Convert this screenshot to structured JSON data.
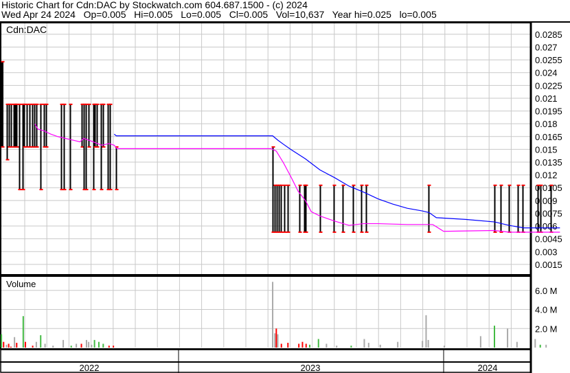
{
  "header": {
    "title": "Historic Chart for Cdn:DAC by Stockwatch.com 604.687.1500 - (c) 2024",
    "stats": "Wed Apr 24 2024   Op=0.005   Hi=0.005   Lo=0.005   Cl=0.005   Vol=10,637   Year hi=0.025   lo=0.005"
  },
  "chart_data": [
    {
      "type": "bar",
      "title": "Cdn:DAC",
      "ylim": [
        0,
        0.0295
      ],
      "xlim": [
        0,
        730
      ],
      "yticks": [
        "0.0285",
        "0.027",
        "0.0255",
        "0.024",
        "0.0225",
        "0.021",
        "0.0195",
        "0.018",
        "0.0165",
        "0.015",
        "0.0135",
        "0.012",
        "0.0105",
        "0.009",
        "0.0075",
        "0.006",
        "0.0045",
        "0.003",
        "0.0015"
      ],
      "ytick_values": [
        0.0285,
        0.027,
        0.0255,
        0.024,
        0.0225,
        0.021,
        0.0195,
        0.018,
        0.0165,
        0.015,
        0.0135,
        0.012,
        0.0105,
        0.009,
        0.0075,
        0.006,
        0.0045,
        0.003,
        0.0015
      ],
      "bars": [
        [
          3,
          0.025,
          0.015
        ],
        [
          9,
          0.02,
          0.0135
        ],
        [
          12,
          0.02,
          0.015
        ],
        [
          15,
          0.02,
          0.015
        ],
        [
          19,
          0.02,
          0.015
        ],
        [
          21,
          0.02,
          0.015
        ],
        [
          23,
          0.02,
          0.015
        ],
        [
          26,
          0.02,
          0.01
        ],
        [
          31,
          0.02,
          0.01
        ],
        [
          33,
          0.02,
          0.015
        ],
        [
          37,
          0.02,
          0.015
        ],
        [
          41,
          0.02,
          0.015
        ],
        [
          44,
          0.02,
          0.015
        ],
        [
          47,
          0.02,
          0.015
        ],
        [
          50,
          0.02,
          0.015
        ],
        [
          56,
          0.02,
          0.01
        ],
        [
          60,
          0.02,
          0.015
        ],
        [
          63,
          0.02,
          0.015
        ],
        [
          84,
          0.02,
          0.01
        ],
        [
          88,
          0.02,
          0.01
        ],
        [
          96,
          0.02,
          0.01
        ],
        [
          112,
          0.02,
          0.015
        ],
        [
          115,
          0.02,
          0.01
        ],
        [
          118,
          0.02,
          0.01
        ],
        [
          122,
          0.02,
          0.015
        ],
        [
          128,
          0.02,
          0.01
        ],
        [
          130,
          0.02,
          0.015
        ],
        [
          133,
          0.02,
          0.015
        ],
        [
          139,
          0.02,
          0.01
        ],
        [
          142,
          0.02,
          0.015
        ],
        [
          148,
          0.02,
          0.01
        ],
        [
          151,
          0.02,
          0.01
        ],
        [
          160,
          0.015,
          0.01
        ],
        [
          375,
          0.015,
          0.005
        ],
        [
          378,
          0.0105,
          0.005
        ],
        [
          381,
          0.0105,
          0.005
        ],
        [
          383,
          0.0105,
          0.005
        ],
        [
          386,
          0.0105,
          0.005
        ],
        [
          391,
          0.0105,
          0.005
        ],
        [
          396,
          0.0105,
          0.005
        ],
        [
          412,
          0.0105,
          0.005
        ],
        [
          418,
          0.0105,
          0.005
        ],
        [
          420,
          0.0105,
          0.005
        ],
        [
          440,
          0.0105,
          0.005
        ],
        [
          459,
          0.0105,
          0.005
        ],
        [
          471,
          0.0105,
          0.005
        ],
        [
          485,
          0.0105,
          0.005
        ],
        [
          497,
          0.0105,
          0.005
        ],
        [
          503,
          0.0105,
          0.005
        ],
        [
          589,
          0.0105,
          0.005
        ],
        [
          680,
          0.0105,
          0.005
        ],
        [
          688,
          0.0105,
          0.005
        ],
        [
          700,
          0.0105,
          0.005
        ],
        [
          712,
          0.0105,
          0.005
        ],
        [
          719,
          0.0105,
          0.005
        ],
        [
          739,
          0.0105,
          0.005
        ],
        [
          743,
          0.0105,
          0.005
        ],
        [
          757,
          0.0105,
          0.005
        ]
      ],
      "series": [
        {
          "name": "long-ma",
          "color": "#0000ff",
          "points": [
            [
              157,
              0.0165
            ],
            [
              160,
              0.0163
            ],
            [
              375,
              0.0163
            ],
            [
              382,
              0.0158
            ],
            [
              390,
              0.0153
            ],
            [
              400,
              0.0147
            ],
            [
              420,
              0.0136
            ],
            [
              440,
              0.0123
            ],
            [
              460,
              0.0114
            ],
            [
              480,
              0.0104
            ],
            [
              500,
              0.0097
            ],
            [
              520,
              0.0089
            ],
            [
              540,
              0.0083
            ],
            [
              560,
              0.0078
            ],
            [
              580,
              0.0075
            ],
            [
              590,
              0.0073
            ],
            [
              600,
              0.0067
            ],
            [
              640,
              0.0065
            ],
            [
              680,
              0.0062
            ],
            [
              700,
              0.0058
            ],
            [
              720,
              0.0055
            ],
            [
              770,
              0.0055
            ]
          ]
        },
        {
          "name": "short-ma",
          "color": "#ff00ff",
          "points": [
            [
              48,
              0.0177
            ],
            [
              52,
              0.0171
            ],
            [
              60,
              0.0169
            ],
            [
              70,
              0.0165
            ],
            [
              80,
              0.0162
            ],
            [
              90,
              0.016
            ],
            [
              100,
              0.0158
            ],
            [
              110,
              0.0156
            ],
            [
              115,
              0.016
            ],
            [
              125,
              0.0157
            ],
            [
              140,
              0.0152
            ],
            [
              150,
              0.0154
            ],
            [
              157,
              0.0152
            ],
            [
              161,
              0.0148
            ],
            [
              373,
              0.0148
            ],
            [
              380,
              0.0145
            ],
            [
              390,
              0.0131
            ],
            [
              400,
              0.0115
            ],
            [
              410,
              0.0098
            ],
            [
              420,
              0.0087
            ],
            [
              428,
              0.0074
            ],
            [
              440,
              0.0069
            ],
            [
              460,
              0.0063
            ],
            [
              480,
              0.0058
            ],
            [
              500,
              0.006
            ],
            [
              520,
              0.006
            ],
            [
              560,
              0.0059
            ],
            [
              595,
              0.0059
            ],
            [
              610,
              0.0051
            ],
            [
              680,
              0.0052
            ],
            [
              700,
              0.005
            ],
            [
              770,
              0.005
            ]
          ]
        }
      ]
    },
    {
      "type": "bar",
      "title": "Volume",
      "ylim": [
        0,
        7.5
      ],
      "yticks": [
        "6.0 M",
        "4.0 M",
        "2.0 M"
      ],
      "ytick_values": [
        6,
        4,
        2
      ],
      "bars": [
        [
          1,
          1.4,
          "g"
        ],
        [
          4,
          0.6,
          "r"
        ],
        [
          8,
          0.3,
          "a"
        ],
        [
          11,
          0.4,
          "r"
        ],
        [
          14,
          0.1,
          "r"
        ],
        [
          19,
          1.1,
          "a"
        ],
        [
          22,
          0.5,
          "r"
        ],
        [
          31,
          3.3,
          "g"
        ],
        [
          34,
          0.6,
          "r"
        ],
        [
          44,
          0.2,
          "r"
        ],
        [
          49,
          0.6,
          "a"
        ],
        [
          55,
          1.3,
          "g"
        ],
        [
          61,
          0.4,
          "a"
        ],
        [
          72,
          0.2,
          "a"
        ],
        [
          86,
          0.8,
          "a"
        ],
        [
          97,
          0.2,
          "g"
        ],
        [
          104,
          0.4,
          "a"
        ],
        [
          111,
          0.4,
          "r"
        ],
        [
          118,
          0.8,
          "a"
        ],
        [
          121,
          0.6,
          "a"
        ],
        [
          125,
          0.3,
          "a"
        ],
        [
          129,
          0.8,
          "g"
        ],
        [
          135,
          0.6,
          "g"
        ],
        [
          141,
          0.4,
          "g"
        ],
        [
          149,
          0.2,
          "r"
        ],
        [
          155,
          0.2,
          "r"
        ],
        [
          374,
          6.9,
          "a"
        ],
        [
          377,
          1.5,
          "a"
        ],
        [
          379,
          2.0,
          "r"
        ],
        [
          381,
          1.4,
          "a"
        ],
        [
          386,
          0.4,
          "r"
        ],
        [
          395,
          0.5,
          "r"
        ],
        [
          410,
          0.4,
          "r"
        ],
        [
          415,
          0.6,
          "r"
        ],
        [
          420,
          0.4,
          "r"
        ],
        [
          425,
          0.3,
          "g"
        ],
        [
          437,
          0.9,
          "g"
        ],
        [
          448,
          0.4,
          "a"
        ],
        [
          462,
          0.2,
          "a"
        ],
        [
          482,
          0.2,
          "g"
        ],
        [
          500,
          0.9,
          "a"
        ],
        [
          506,
          0.5,
          "a"
        ],
        [
          522,
          0.3,
          "a"
        ],
        [
          546,
          0.6,
          "a"
        ],
        [
          580,
          0.7,
          "a"
        ],
        [
          585,
          3.4,
          "a"
        ],
        [
          588,
          0.8,
          "a"
        ],
        [
          610,
          0.2,
          "a"
        ],
        [
          660,
          1.2,
          "a"
        ],
        [
          679,
          2.3,
          "g"
        ],
        [
          697,
          2.0,
          "a"
        ],
        [
          710,
          0.6,
          "a"
        ],
        [
          735,
          0.9,
          "a"
        ],
        [
          742,
          0.3,
          "g"
        ],
        [
          750,
          0.3,
          "a"
        ]
      ]
    }
  ],
  "xaxis": {
    "years": [
      "2022",
      "2023",
      "2024"
    ]
  }
}
